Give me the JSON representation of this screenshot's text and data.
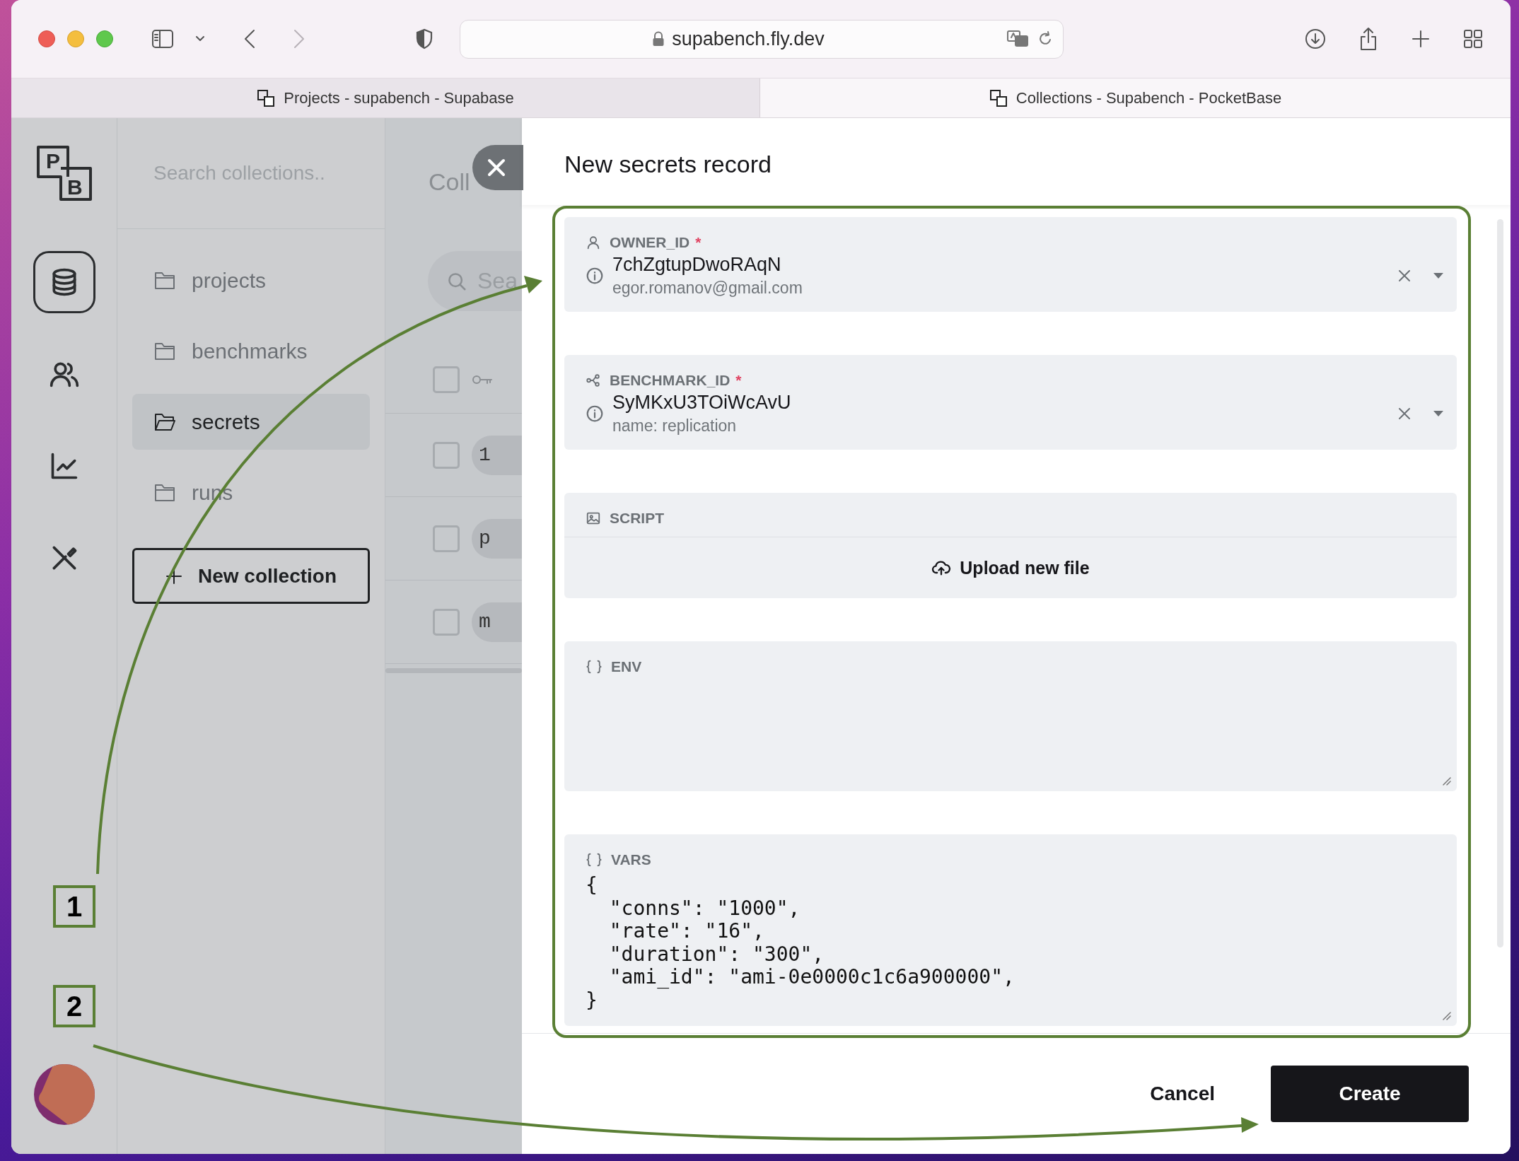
{
  "browser": {
    "url": "supabench.fly.dev",
    "can_go_forward": false,
    "tabs": [
      {
        "title": "Projects - supabench - Supabase",
        "selected": false
      },
      {
        "title": "Collections - Supabench - PocketBase",
        "selected": true
      }
    ]
  },
  "app": {
    "logo": [
      "P",
      "B"
    ],
    "nav": [
      {
        "kind": "collections",
        "selected": true
      },
      {
        "kind": "users",
        "selected": false
      },
      {
        "kind": "logs",
        "selected": false
      },
      {
        "kind": "settings",
        "selected": false
      }
    ],
    "sidebar": {
      "search_placeholder": "Search collections..",
      "collections": [
        {
          "name": "projects",
          "selected": false
        },
        {
          "name": "benchmarks",
          "selected": false
        },
        {
          "name": "secrets",
          "selected": true
        },
        {
          "name": "runs",
          "selected": false
        }
      ],
      "new_button": "New collection"
    },
    "records": {
      "title": "Coll",
      "search_placeholder": "Sea",
      "header_checked": false,
      "rows": [
        {
          "checked": false,
          "cell": "1"
        },
        {
          "checked": false,
          "cell": "p"
        },
        {
          "checked": false,
          "cell": "m"
        }
      ]
    }
  },
  "modal": {
    "title": "New secrets record",
    "fields": [
      {
        "kind": "relation",
        "label": "OWNER_ID",
        "required_mark": "*",
        "value": "7chZgtupDwoRAqN",
        "detail": "egor.romanov@gmail.com"
      },
      {
        "kind": "relation",
        "label": "BENCHMARK_ID",
        "required_mark": "*",
        "value": "SyMKxU3TOiWcAvU",
        "detail": "name: replication"
      },
      {
        "kind": "file",
        "label": "SCRIPT",
        "button": "Upload new file"
      },
      {
        "kind": "json",
        "label": "ENV"
      },
      {
        "kind": "json",
        "label": "VARS",
        "value": "{\n  \"conns\": \"1000\",\n  \"rate\": \"16\",\n  \"duration\": \"300\",\n  \"ami_id\": \"ami-0e0000c1c6a900000\",\n}"
      }
    ],
    "buttons": {
      "cancel": "Cancel",
      "submit": "Create"
    }
  },
  "annotations": {
    "markers": [
      {
        "label": "1"
      },
      {
        "label": "2"
      }
    ]
  }
}
